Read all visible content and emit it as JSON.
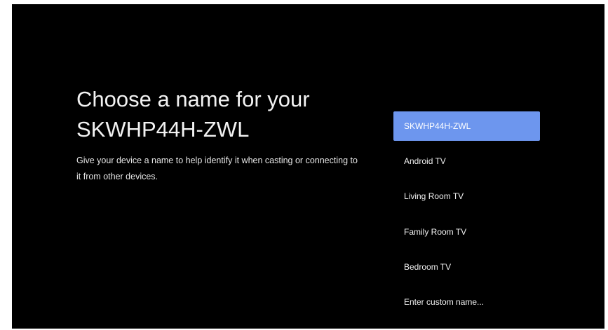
{
  "screen": {
    "title_line1": "Choose a name for your",
    "title_line2": "SKWHP44H-ZWL",
    "description": "Give your device a name to help identify it when casting or connecting to it from other devices."
  },
  "name_options": [
    {
      "label": "SKWHP44H-ZWL",
      "selected": true
    },
    {
      "label": "Android TV",
      "selected": false
    },
    {
      "label": "Living Room TV",
      "selected": false
    },
    {
      "label": "Family Room TV",
      "selected": false
    },
    {
      "label": "Bedroom TV",
      "selected": false
    },
    {
      "label": "Enter custom name...",
      "selected": false
    }
  ],
  "colors": {
    "background": "#000000",
    "selected_highlight": "#6d96ee",
    "text": "#f2f2f2"
  }
}
